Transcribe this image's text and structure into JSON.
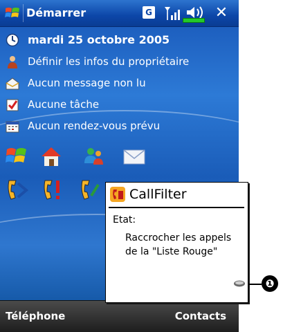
{
  "titlebar": {
    "title": "Démarrer",
    "gprs_badge": "G",
    "icons": [
      "windows-flag-icon",
      "signal-icon",
      "volume-icon",
      "close-icon"
    ],
    "close_label": "✕"
  },
  "today": {
    "items": [
      {
        "icon": "clock-icon",
        "label": "mardi 25 octobre 2005"
      },
      {
        "icon": "owner-icon",
        "label": "Définir les infos du propriétaire"
      },
      {
        "icon": "inbox-icon",
        "label": "Aucun message non lu"
      },
      {
        "icon": "tasks-icon",
        "label": "Aucune tâche"
      },
      {
        "icon": "calendar-icon",
        "label": "Aucun rendez-vous prévu"
      }
    ],
    "quick_icons": [
      "windows-logo-icon",
      "home-icon",
      "contacts-icon",
      "mail-icon"
    ],
    "call_icons": [
      "call-filter-icon",
      "call-alert-icon",
      "call-forward-icon"
    ]
  },
  "popup": {
    "title": "CallFilter",
    "label": "Etat:",
    "body": "Raccrocher les appels de la \"Liste Rouge\""
  },
  "callout": {
    "number": "❶"
  },
  "softkeys": {
    "left": "Téléphone",
    "right": "Contacts"
  },
  "colors": {
    "titlebar": "#0c46a8",
    "today_bg": "#2d7ad6",
    "softbar": "#2a2a2a",
    "battery": "#24c92a"
  }
}
